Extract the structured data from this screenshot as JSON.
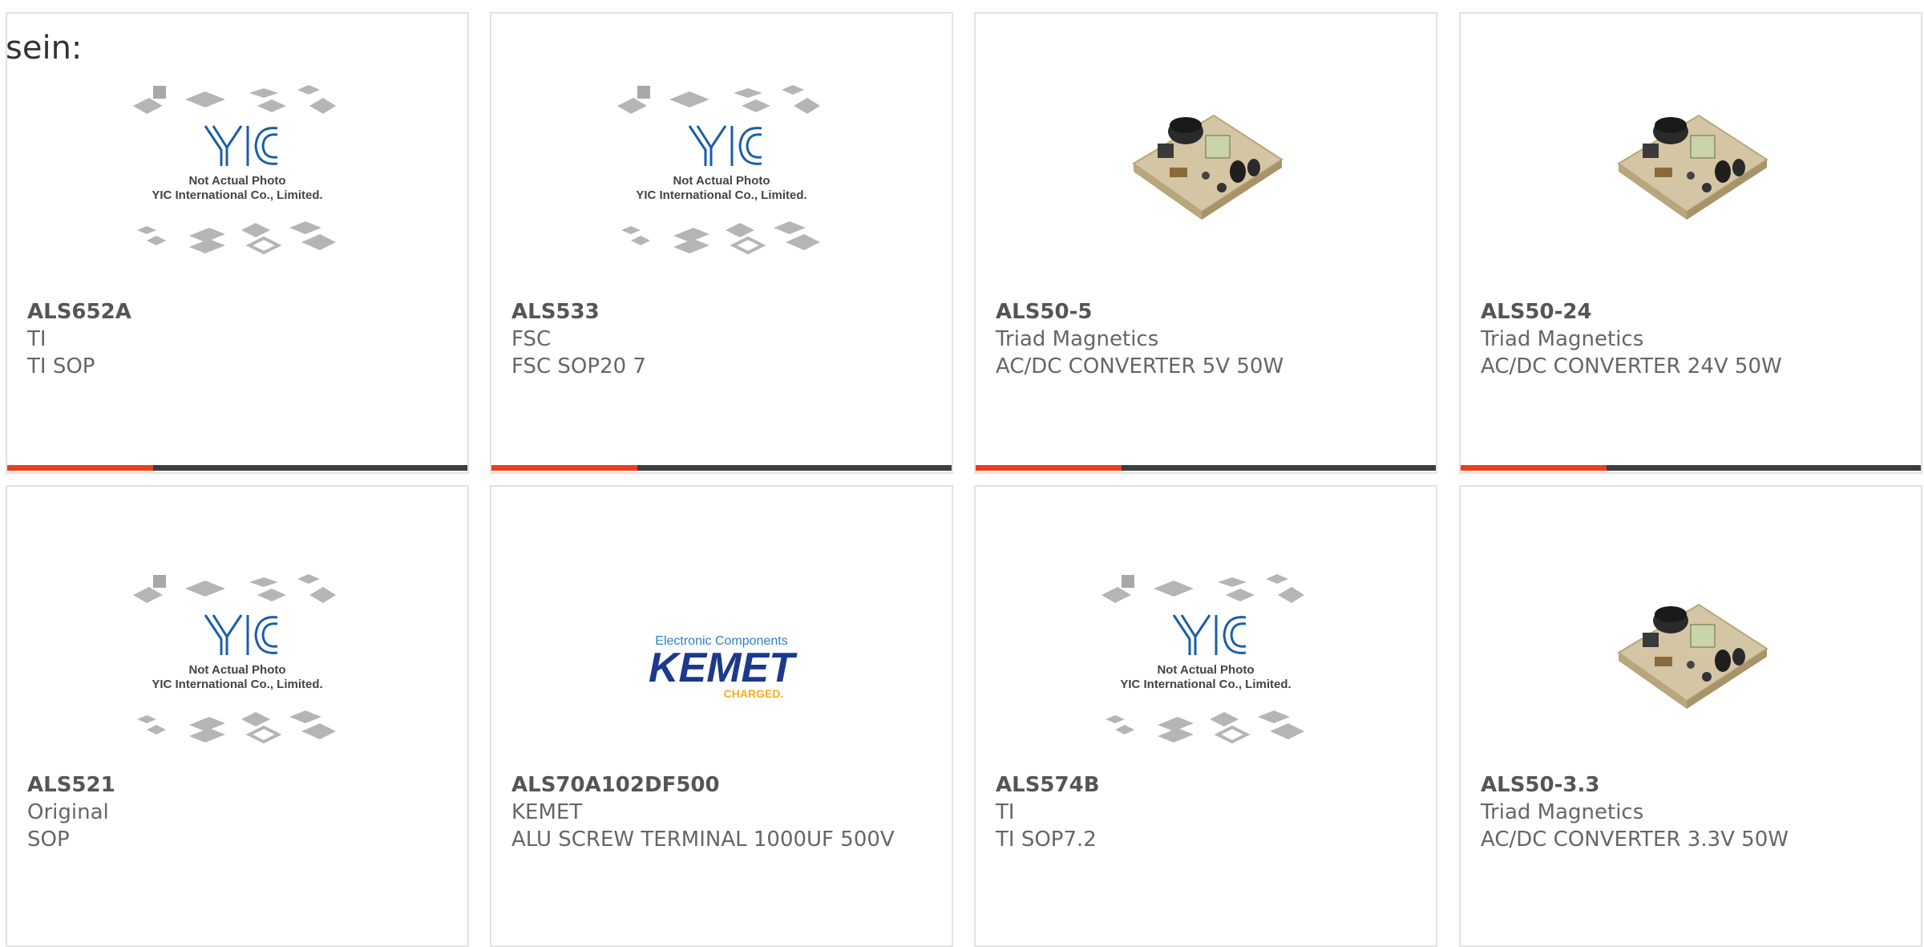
{
  "page": {
    "heading": "sein:"
  },
  "yic_caption": {
    "line1": "Not Actual Photo",
    "line2": "YIC International Co., Limited."
  },
  "kemet_logo": {
    "top": "Electronic Components",
    "brand": "KEMET",
    "tag": "CHARGED."
  },
  "colors": {
    "accent": "#e8401e",
    "bar": "#3d3d3d",
    "yic_blue": "#1a5ea8",
    "kemet_blue": "#1b3a8c",
    "kemet_gold": "#f2b01e"
  },
  "products": [
    {
      "name": "ALS652A",
      "brand": "TI",
      "desc": "TI SOP",
      "image": "yic-placeholder"
    },
    {
      "name": "ALS533",
      "brand": "FSC",
      "desc": "FSC SOP20 7",
      "image": "yic-placeholder"
    },
    {
      "name": "ALS50-5",
      "brand": "Triad Magnetics",
      "desc": "AC/DC CONVERTER 5V 50W",
      "image": "power-supply-board"
    },
    {
      "name": "ALS50-24",
      "brand": "Triad Magnetics",
      "desc": "AC/DC CONVERTER 24V 50W",
      "image": "power-supply-board"
    },
    {
      "name": "ALS521",
      "brand": "Original",
      "desc": "SOP",
      "image": "yic-placeholder"
    },
    {
      "name": "ALS70A102DF500",
      "brand": "KEMET",
      "desc": "ALU SCREW TERMINAL 1000UF 500V",
      "image": "kemet-logo"
    },
    {
      "name": "ALS574B",
      "brand": "TI",
      "desc": "TI SOP7.2",
      "image": "yic-placeholder"
    },
    {
      "name": "ALS50-3.3",
      "brand": "Triad Magnetics",
      "desc": "AC/DC CONVERTER 3.3V 50W",
      "image": "power-supply-board"
    }
  ]
}
